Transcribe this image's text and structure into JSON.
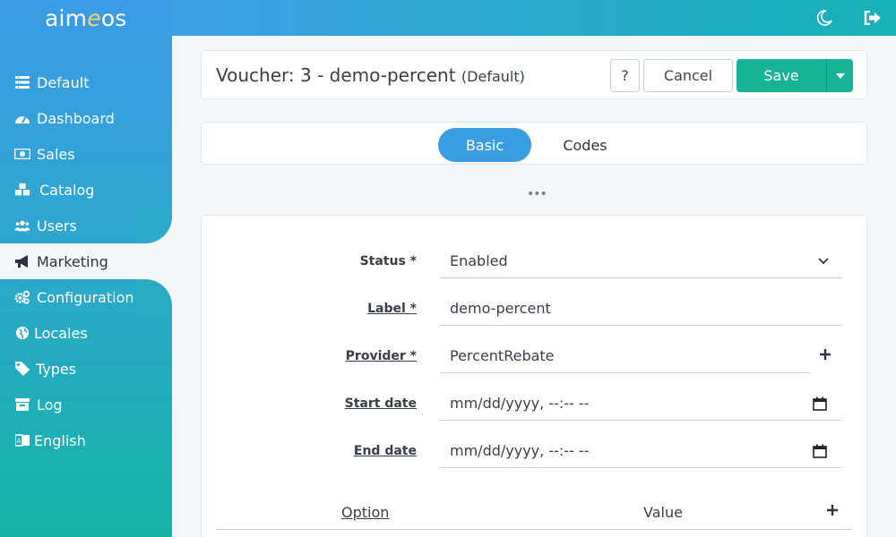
{
  "brand": {
    "logo_pre": "aim",
    "logo_e": "e",
    "logo_post": "os"
  },
  "sidebar": {
    "items": [
      {
        "label": "Default",
        "icon": "list-icon"
      },
      {
        "label": "Dashboard",
        "icon": "gauge-icon"
      },
      {
        "label": "Sales",
        "icon": "money-icon"
      },
      {
        "label": "Catalog",
        "icon": "cubes-icon"
      },
      {
        "label": "Users",
        "icon": "users-icon"
      },
      {
        "label": "Marketing",
        "icon": "megaphone-icon"
      },
      {
        "label": "Configuration",
        "icon": "cogs-icon"
      },
      {
        "label": "Locales",
        "icon": "globe-icon"
      },
      {
        "label": "Types",
        "icon": "tag-icon"
      },
      {
        "label": "Log",
        "icon": "archive-icon"
      },
      {
        "label": "English",
        "icon": "language-icon"
      }
    ],
    "active": "Marketing"
  },
  "topbar": {
    "icons": [
      "moon-icon",
      "logout-icon"
    ]
  },
  "header": {
    "title": "Voucher: 3 - demo-percent",
    "site": "(Default)",
    "help_label": "?",
    "cancel_label": "Cancel",
    "save_label": "Save"
  },
  "tabs": [
    {
      "label": "Basic",
      "active": true
    },
    {
      "label": "Codes",
      "active": false
    }
  ],
  "more_label": "•••",
  "form": {
    "status": {
      "label": "Status *",
      "value": "Enabled"
    },
    "label_field": {
      "label": "Label",
      "req": "*",
      "value": "demo-percent"
    },
    "provider": {
      "label": "Provider",
      "req": "*",
      "value": "PercentRebate"
    },
    "start_date": {
      "label": "Start date",
      "value": "mm/dd/yyyy, --:-- --"
    },
    "end_date": {
      "label": "End date",
      "value": "mm/dd/yyyy, --:-- --"
    }
  },
  "options": {
    "col_option": "Option",
    "col_value": "Value"
  },
  "colors": {
    "accent": "#3a9de2",
    "save": "#17b397",
    "sidebar_top": "#3c9be6",
    "sidebar_bottom": "#16b3a4"
  }
}
